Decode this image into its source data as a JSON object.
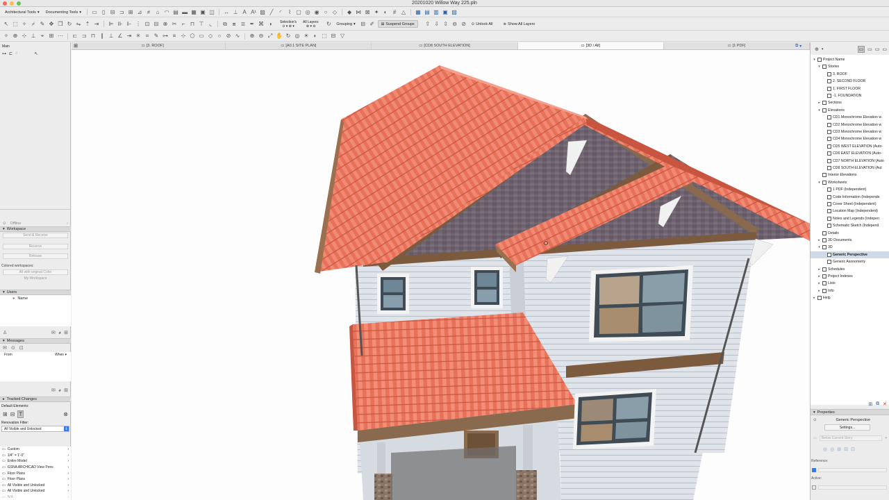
{
  "window": {
    "title": "20201020 Willow Way 225.pln"
  },
  "toolbar": {
    "arch_tools": "Architectural Tools",
    "doc_tools": "Documenting Tools",
    "selections": "Selection's",
    "all_layers": "All Layers:",
    "grouping": "Grouping",
    "suspend_groups": "Suspend Groups",
    "unlock_all": "Unlock All",
    "show_all_layers": "Show All Layers"
  },
  "tabs": [
    {
      "label": "[3. ROOF]"
    },
    {
      "label": "[A0.1 SITE PLAN]"
    },
    {
      "label": "[CD8 SOUTH ELEVATION]"
    },
    {
      "label": "[3D / All]"
    },
    {
      "label": "[1 PDF]"
    }
  ],
  "left": {
    "main_label": "Main",
    "offline": "Offline",
    "workspace": "Workspace",
    "send_receive": "Send & Receive",
    "reserve": "Reserve",
    "release": "Release",
    "colored_ws": "Colored workspaces:",
    "all_original": "All with original Color",
    "my_workspace": "My Workspace",
    "users": "Users",
    "name": "Name",
    "messages": "Messages",
    "from": "From",
    "when": "When",
    "tracked": "Tracked Changes",
    "default_elements": "Default Elements:",
    "renovation_filter": "Renovation Filter:",
    "renovation_value": "All Visible and Unlocked",
    "settings_list": [
      {
        "label": "Custom"
      },
      {
        "label": "1/4\"  =   1'-0\""
      },
      {
        "label": "Entire Model"
      },
      {
        "label": "GSNA ARCHICAD View Pens"
      },
      {
        "label": "Floor Plans"
      },
      {
        "label": "Floor Plans"
      },
      {
        "label": "All Visible and Unlocked"
      },
      {
        "label": "All Visible and Unlocked"
      },
      {
        "label": "N/A"
      }
    ]
  },
  "navigator": {
    "items": [
      {
        "label": "Project Name",
        "tri": "▾",
        "indent": 0
      },
      {
        "label": "Stories",
        "tri": "▾",
        "indent": 1
      },
      {
        "label": "3. ROOF",
        "tri": "",
        "indent": 2
      },
      {
        "label": "2. SECOND FLOOR",
        "tri": "",
        "indent": 2
      },
      {
        "label": "1. FIRST FLOOR",
        "tri": "",
        "indent": 2
      },
      {
        "label": "-1. FOUNDATION",
        "tri": "",
        "indent": 2
      },
      {
        "label": "Sections",
        "tri": "▸",
        "indent": 1
      },
      {
        "label": "Elevations",
        "tri": "▾",
        "indent": 1
      },
      {
        "label": "CD1 Monochrome Elevation w",
        "tri": "",
        "indent": 2
      },
      {
        "label": "CD2 Monochrome Elevation w",
        "tri": "",
        "indent": 2
      },
      {
        "label": "CD3 Monochrome Elevation w",
        "tri": "",
        "indent": 2
      },
      {
        "label": "CD4 Monochrome Elevation w",
        "tri": "",
        "indent": 2
      },
      {
        "label": "CD5 WEST ELEVATION (Auto-",
        "tri": "",
        "indent": 2
      },
      {
        "label": "CD6 EAST ELEVATION (Auto-",
        "tri": "",
        "indent": 2
      },
      {
        "label": "CD7 NORTH ELEVATION (Auto",
        "tri": "",
        "indent": 2
      },
      {
        "label": "CD8 SOUTH ELEVATION (Aut",
        "tri": "",
        "indent": 2
      },
      {
        "label": "Interior Elevations",
        "tri": "",
        "indent": 1
      },
      {
        "label": "Worksheets",
        "tri": "▾",
        "indent": 1
      },
      {
        "label": "1 PDF (Independent)",
        "tri": "",
        "indent": 2
      },
      {
        "label": "Code Information (Independe",
        "tri": "",
        "indent": 2
      },
      {
        "label": "Cover Sheet (Independent)",
        "tri": "",
        "indent": 2
      },
      {
        "label": "Location Map (Independent)",
        "tri": "",
        "indent": 2
      },
      {
        "label": "Notes and Legends (Indepen",
        "tri": "",
        "indent": 2
      },
      {
        "label": "Schematic Sketch (Independ",
        "tri": "",
        "indent": 2
      },
      {
        "label": "Details",
        "tri": "",
        "indent": 1
      },
      {
        "label": "3D Documents",
        "tri": "▸",
        "indent": 1
      },
      {
        "label": "3D",
        "tri": "▾",
        "indent": 1
      },
      {
        "label": "Generic Perspective",
        "tri": "",
        "indent": 2,
        "selected": true
      },
      {
        "label": "Generic Axonometry",
        "tri": "",
        "indent": 2
      },
      {
        "label": "Schedules",
        "tri": "▸",
        "indent": 1
      },
      {
        "label": "Project Indexes",
        "tri": "▸",
        "indent": 1
      },
      {
        "label": "Lists",
        "tri": "▸",
        "indent": 1
      },
      {
        "label": "Info",
        "tri": "▸",
        "indent": 1
      },
      {
        "label": "Help",
        "tri": "▸",
        "indent": 0
      }
    ]
  },
  "properties": {
    "title": "Properties",
    "name": "Generic Perspective",
    "settings": "Settings...",
    "below_story": "Below Current Story",
    "reference": "Reference:",
    "active": "Active:"
  },
  "colors": {
    "roof": "#e8715a",
    "roof_dark": "#c8553f",
    "siding": "#dfe3ea",
    "shingle": "#6f6470",
    "trim": "#7b5a3e",
    "window_frame": "#3f4c55",
    "accent_blue": "#2c5fa8",
    "selection": "#cfd9e8"
  }
}
